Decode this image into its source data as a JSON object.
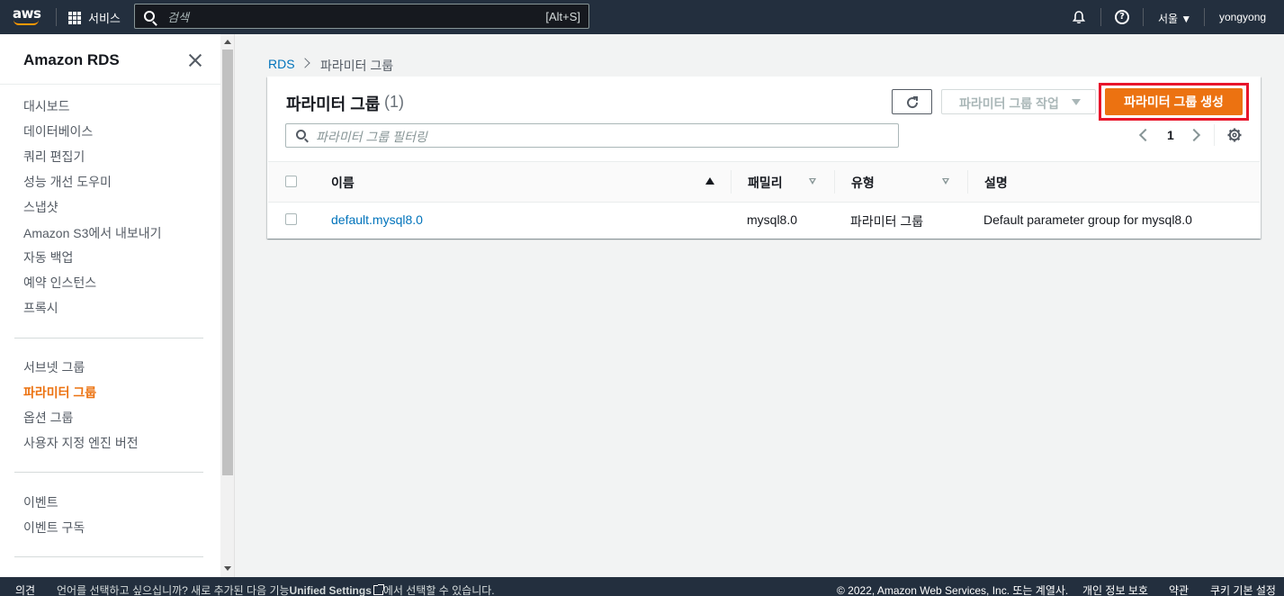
{
  "topnav": {
    "logo": "aws",
    "services_label": "서비스",
    "search_placeholder": "검색",
    "search_shortcut": "[Alt+S]",
    "region": "서울 ▼",
    "user": "yongyong",
    "icons": [
      "grid-icon",
      "search-icon",
      "bell-icon",
      "help-icon"
    ]
  },
  "sidebar": {
    "title": "Amazon RDS",
    "group1": [
      "대시보드",
      "데이터베이스",
      "쿼리 편집기",
      "성능 개선 도우미",
      "스냅샷",
      "Amazon S3에서 내보내기",
      "자동 백업",
      "예약 인스턴스",
      "프록시"
    ],
    "group2": [
      "서브넷 그룹",
      "파라미터 그룹",
      "옵션 그룹",
      "사용자 지정 엔진 버전"
    ],
    "group3": [
      "이벤트",
      "이벤트 구독"
    ],
    "active_item": "파라미터 그룹"
  },
  "breadcrumb": {
    "root": "RDS",
    "current": "파라미터 그룹"
  },
  "panel": {
    "title": "파라미터 그룹",
    "count": "(1)",
    "actions_label": "파라미터 그룹 작업",
    "create_label": "파라미터 그룹 생성",
    "filter_placeholder": "파라미터 그룹 필터링",
    "page": "1"
  },
  "table": {
    "columns": [
      "이름",
      "패밀리",
      "유형",
      "설명"
    ],
    "rows": [
      {
        "name": "default.mysql8.0",
        "family": "mysql8.0",
        "type": "파라미터 그룹",
        "description": "Default parameter group for mysql8.0"
      }
    ]
  },
  "footer": {
    "feedback": "의견",
    "lang_msg_prefix": "언어를 선택하고 싶으십니까? 새로 추가된 다음 기능",
    "lang_link": "Unified Settings",
    "lang_msg_suffix": "에서 선택할 수 있습니다.",
    "copyright": "© 2022, Amazon Web Services, Inc. 또는 계열사.",
    "privacy": "개인 정보 보호",
    "terms": "약관",
    "cookies": "쿠키 기본 설정"
  },
  "colors": {
    "nav_bg": "#232f3e",
    "accent_orange": "#ec7211",
    "link_blue": "#0073bb",
    "highlight_red": "#e8152b"
  }
}
